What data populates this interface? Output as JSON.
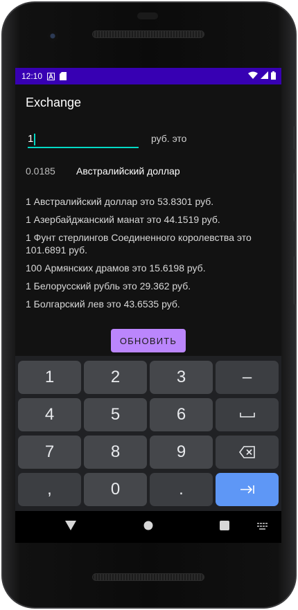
{
  "status_bar": {
    "time": "12:10",
    "left_icons": [
      "font-icon",
      "sd-card-icon"
    ],
    "right_icons": [
      "wifi-icon",
      "signal-icon",
      "battery-icon"
    ]
  },
  "app": {
    "title": "Exchange",
    "amount_input": {
      "value": "1"
    },
    "rub_label": "руб. это",
    "selected_rate": "0.0185",
    "selected_currency": "Австралийский доллар",
    "rates": [
      "1 Австралийский доллар это 53.8301 руб.",
      "1 Азербайджанский манат это 44.1519 руб.",
      "1 Фунт стерлингов Соединенного королевства это 101.6891 руб.",
      "100 Армянских драмов это 15.6198 руб.",
      "1 Белорусский рубль это 29.362 руб.",
      "1 Болгарский лев это 43.6535 руб."
    ],
    "refresh_button": "ОБНОВИТЬ"
  },
  "keyboard": {
    "keys": [
      "1",
      "2",
      "3",
      "–",
      "4",
      "5",
      "6",
      "space-icon",
      "7",
      "8",
      "9",
      "backspace-icon",
      ",",
      "0",
      ".",
      "next-icon"
    ]
  },
  "colors": {
    "status_bar": "#3700b3",
    "background": "#121212",
    "accent_teal": "#03dac5",
    "button_purple": "#bb86fc",
    "key_blue": "#5e97f6"
  }
}
